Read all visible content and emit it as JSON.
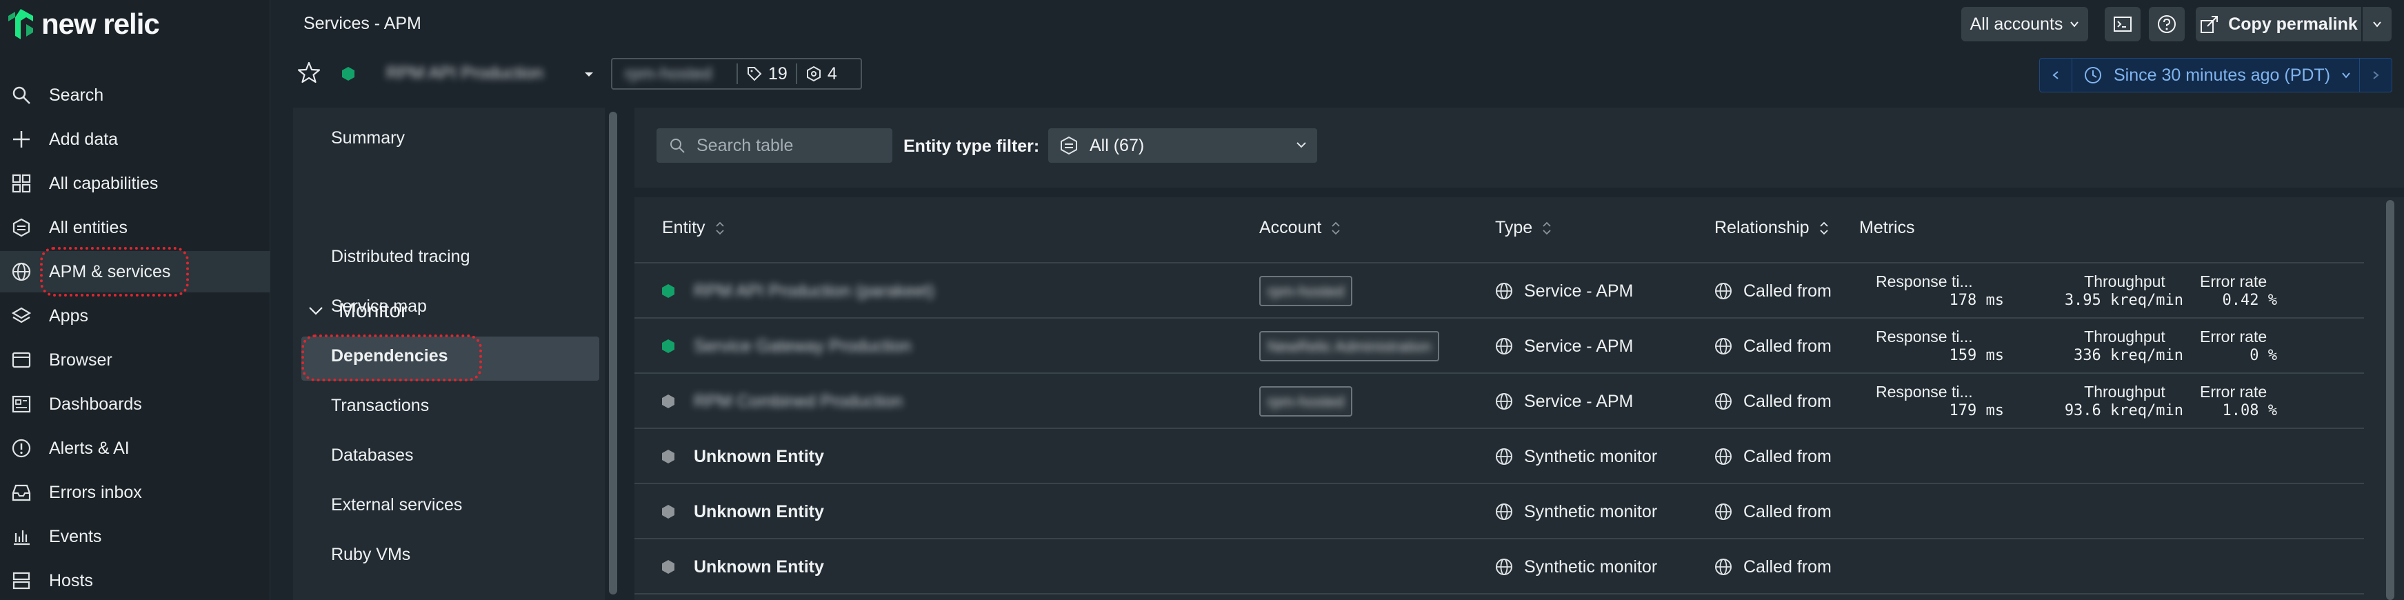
{
  "brand": {
    "name": "new relic",
    "accent": "#1ce783"
  },
  "nav": {
    "items": [
      {
        "label": "Search",
        "icon": "search-icon"
      },
      {
        "label": "Add data",
        "icon": "plus-icon"
      },
      {
        "label": "All capabilities",
        "icon": "grid-icon"
      },
      {
        "label": "All entities",
        "icon": "entities-icon"
      },
      {
        "label": "APM & services",
        "icon": "globe-icon"
      },
      {
        "label": "Apps",
        "icon": "layers-icon"
      },
      {
        "label": "Browser",
        "icon": "browser-icon"
      },
      {
        "label": "Dashboards",
        "icon": "dashboard-icon"
      },
      {
        "label": "Alerts & AI",
        "icon": "alert-icon"
      },
      {
        "label": "Errors inbox",
        "icon": "inbox-icon"
      },
      {
        "label": "Events",
        "icon": "chart-bars-icon"
      },
      {
        "label": "Hosts",
        "icon": "hosts-icon"
      }
    ]
  },
  "header": {
    "breadcrumb": "Services - APM",
    "entity_name": "RPM API Production",
    "tag_account": "rpm-hosted",
    "tag_count": "19",
    "related_count": "4",
    "accounts_button": "All accounts",
    "copy_permalink": "Copy permalink",
    "time_picker": "Since 30 minutes ago (PDT)"
  },
  "subnav": {
    "summary": "Summary",
    "monitor_section": "Monitor",
    "items": [
      "Distributed tracing",
      "Service map",
      "Dependencies",
      "Transactions",
      "Databases",
      "External services",
      "Ruby VMs"
    ]
  },
  "filter": {
    "search_placeholder": "Search table",
    "entity_type_label": "Entity type filter:",
    "entity_type_value": "All (67)"
  },
  "table": {
    "columns": [
      "Entity",
      "Account",
      "Type",
      "Relationship",
      "Metrics"
    ],
    "metric_labels": {
      "response": "Response ti...",
      "throughput": "Throughput",
      "error": "Error rate"
    },
    "status_colors": {
      "healthy": "#13a16a",
      "unknown": "#8f9599"
    },
    "rows": [
      {
        "entity": "RPM API Production (parakeet)",
        "status": "healthy",
        "account": "rpm-hosted",
        "type": "Service - APM",
        "relationship": "Called from",
        "response": "178 ms",
        "throughput": "3.95 kreq/min",
        "error": "0.42 %"
      },
      {
        "entity": "Service Gateway Production",
        "status": "healthy",
        "account": "NewRelic Administration",
        "type": "Service - APM",
        "relationship": "Called from",
        "response": "159 ms",
        "throughput": "336 kreq/min",
        "error": "0 %"
      },
      {
        "entity": "RPM Combined Production",
        "status": "unknown",
        "account": "rpm-hosted",
        "type": "Service - APM",
        "relationship": "Called from",
        "response": "179 ms",
        "throughput": "93.6 kreq/min",
        "error": "1.08 %"
      },
      {
        "entity": "Unknown Entity",
        "status": "unknown",
        "account": "",
        "type": "Synthetic monitor",
        "relationship": "Called from"
      },
      {
        "entity": "Unknown Entity",
        "status": "unknown",
        "account": "",
        "type": "Synthetic monitor",
        "relationship": "Called from"
      },
      {
        "entity": "Unknown Entity",
        "status": "unknown",
        "account": "",
        "type": "Synthetic monitor",
        "relationship": "Called from"
      }
    ]
  }
}
